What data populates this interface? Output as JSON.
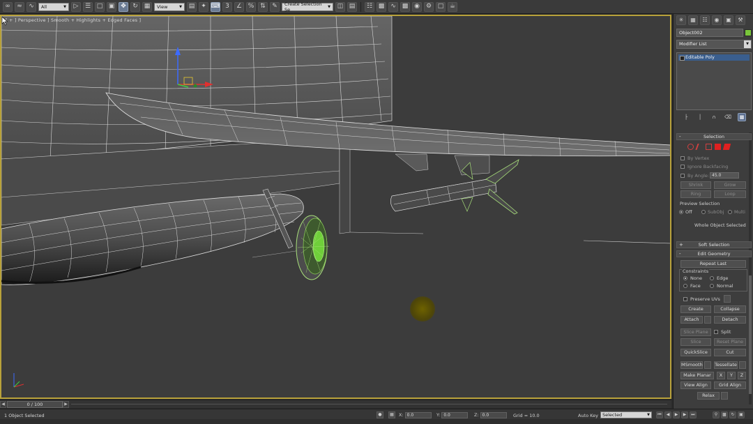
{
  "toolbar": {
    "selection_filter": "All",
    "reference_coord": "View",
    "named_selection": "Create Selection Se"
  },
  "viewport": {
    "label": "[ + ] Perspective ] Smooth + Highlights + Edged Faces ]"
  },
  "timeline": {
    "frame": "0 / 100"
  },
  "status": {
    "text": "1 Object Selected",
    "x_label": "X:",
    "x_value": "0.0",
    "y_label": "Y:",
    "y_value": "0.0",
    "z_label": "Z:",
    "z_value": "0.0",
    "grid": "Grid = 10.0",
    "autokey": "Auto Key",
    "key_filter": "Selected"
  },
  "panel": {
    "object_name": "Object002",
    "object_color": "#79c63a",
    "modifier_list": "Modifier List",
    "stack_item": "Editable Poly",
    "selection": {
      "title": "Selection",
      "by_vertex": "By Vertex",
      "ignore_backfacing": "Ignore Backfacing",
      "by_angle": "By Angle:",
      "angle_value": "45.0",
      "shrink": "Shrink",
      "grow": "Grow",
      "ring": "Ring",
      "loop": "Loop",
      "preview_title": "Preview Selection",
      "preview_off": "Off",
      "preview_subobj": "SubObj",
      "preview_multi": "Multi",
      "info": "Whole Object Selected"
    },
    "soft_selection": "Soft Selection",
    "edit_geometry": {
      "title": "Edit Geometry",
      "repeat_last": "Repeat Last",
      "constraints": "Constraints",
      "none": "None",
      "edge": "Edge",
      "face": "Face",
      "normal": "Normal",
      "preserve_uvs": "Preserve UVs",
      "create": "Create",
      "collapse": "Collapse",
      "attach": "Attach",
      "detach": "Detach",
      "slice_plane": "Slice Plane",
      "split": "Split",
      "slice": "Slice",
      "reset_plane": "Reset Plane",
      "quickslice": "QuickSlice",
      "cut": "Cut",
      "msmooth": "MSmooth",
      "tessellate": "Tessellate",
      "make_planar": "Make Planar",
      "x": "X",
      "y": "Y",
      "z": "Z",
      "view_align": "View Align",
      "grid_align": "Grid Align",
      "relax": "Relax"
    }
  }
}
